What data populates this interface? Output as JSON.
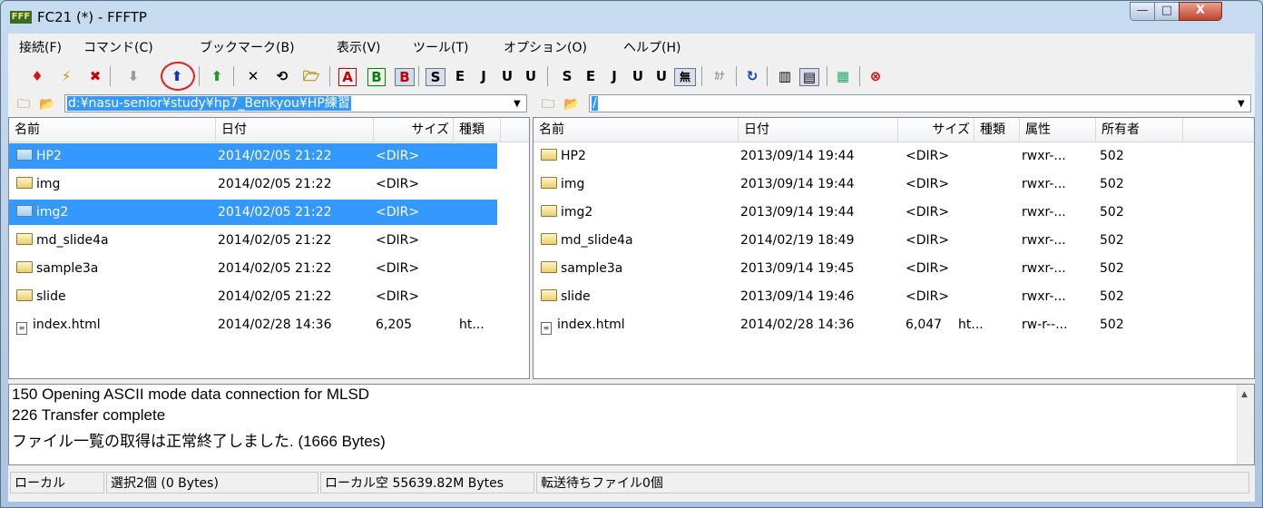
{
  "window": {
    "title": "FC21 (*) - FFFTP",
    "app_icon": "FFF",
    "buttons": {
      "min": "—",
      "max": "□",
      "close": "X"
    }
  },
  "menu": [
    "接続(F)",
    "コマンド(C)",
    "ブックマーク(B)",
    "表示(V)",
    "ツール(T)",
    "オプション(O)",
    "ヘルプ(H)"
  ],
  "toolbar": {
    "glyphs": [
      "♦",
      "⚡",
      "✖",
      "⬇",
      "⬆",
      "⬆",
      "✕",
      "⟲",
      "🗁",
      "A",
      "B",
      "B",
      "S",
      "E",
      "J",
      "U",
      "U",
      "S",
      "E",
      "J",
      "U",
      "U",
      "無",
      "ｶﾅ",
      "↻",
      "▥",
      "▤",
      "▦",
      "⊗"
    ]
  },
  "local": {
    "path": "d:¥nasu-senior¥study¥hp7_Benkyou¥HP練習",
    "columns": [
      "名前",
      "日付",
      "サイズ",
      "種類"
    ],
    "rows": [
      {
        "name": "HP2",
        "date": "2014/02/05 21:22",
        "size": "<DIR>",
        "type": "",
        "folder": true,
        "selected": true
      },
      {
        "name": "img",
        "date": "2014/02/05 21:22",
        "size": "<DIR>",
        "type": "",
        "folder": true,
        "selected": false
      },
      {
        "name": "img2",
        "date": "2014/02/05 21:22",
        "size": "<DIR>",
        "type": "",
        "folder": true,
        "selected": true
      },
      {
        "name": "md_slide4a",
        "date": "2014/02/05 21:22",
        "size": "<DIR>",
        "type": "",
        "folder": true,
        "selected": false
      },
      {
        "name": "sample3a",
        "date": "2014/02/05 21:22",
        "size": "<DIR>",
        "type": "",
        "folder": true,
        "selected": false
      },
      {
        "name": "slide",
        "date": "2014/02/05 21:22",
        "size": "<DIR>",
        "type": "",
        "folder": true,
        "selected": false
      },
      {
        "name": "index.html",
        "date": "2014/02/28 14:36",
        "size": "6,205",
        "type": "ht...",
        "folder": false,
        "selected": false
      }
    ]
  },
  "remote": {
    "path": "/",
    "columns": [
      "名前",
      "日付",
      "サイズ",
      "種類",
      "属性",
      "所有者"
    ],
    "rows": [
      {
        "name": "HP2",
        "date": "2013/09/14 19:44",
        "size": "<DIR>",
        "type": "",
        "attr": "rwxr-...",
        "owner": "502",
        "folder": true
      },
      {
        "name": "img",
        "date": "2013/09/14 19:44",
        "size": "<DIR>",
        "type": "",
        "attr": "rwxr-...",
        "owner": "502",
        "folder": true
      },
      {
        "name": "img2",
        "date": "2013/09/14 19:44",
        "size": "<DIR>",
        "type": "",
        "attr": "rwxr-...",
        "owner": "502",
        "folder": true
      },
      {
        "name": "md_slide4a",
        "date": "2014/02/19 18:49",
        "size": "<DIR>",
        "type": "",
        "attr": "rwxr-...",
        "owner": "502",
        "folder": true
      },
      {
        "name": "sample3a",
        "date": "2013/09/14 19:45",
        "size": "<DIR>",
        "type": "",
        "attr": "rwxr-...",
        "owner": "502",
        "folder": true
      },
      {
        "name": "slide",
        "date": "2013/09/14 19:46",
        "size": "<DIR>",
        "type": "",
        "attr": "rwxr-...",
        "owner": "502",
        "folder": true
      },
      {
        "name": "index.html",
        "date": "2014/02/28 14:36",
        "size": "6,047",
        "type": "ht...",
        "attr": "rw-r--...",
        "owner": "502",
        "folder": false
      }
    ]
  },
  "log": [
    "150 Opening ASCII mode data connection for MLSD",
    "226 Transfer complete",
    "ファイル一覧の取得は正常終了しました. (1666 Bytes)"
  ],
  "status": [
    "ローカル",
    "選択2個 (0 Bytes)",
    "ローカル空 55639.82M Bytes",
    "転送待ちファイル0個"
  ],
  "colors": {
    "selection": "#3399ff",
    "annotation": "#e02020"
  }
}
